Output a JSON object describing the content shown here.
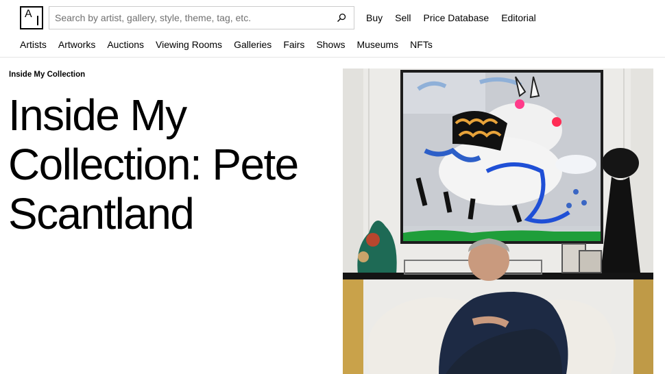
{
  "header": {
    "logo_letter": "A",
    "search": {
      "placeholder": "Search by artist, gallery, style, theme, tag, etc.",
      "value": ""
    },
    "top_links": [
      "Buy",
      "Sell",
      "Price Database",
      "Editorial"
    ]
  },
  "nav": {
    "items": [
      "Artists",
      "Artworks",
      "Auctions",
      "Viewing Rooms",
      "Galleries",
      "Fairs",
      "Shows",
      "Museums",
      "NFTs"
    ]
  },
  "article": {
    "kicker": "Inside My Collection",
    "title_lines": [
      "Inside My",
      "Collection: Pete",
      "Scantland"
    ]
  },
  "colors": {
    "text": "#000000",
    "muted": "#707070",
    "border": "#cccccc",
    "divider": "#e5e5e5"
  },
  "icons": [
    "search-icon"
  ]
}
